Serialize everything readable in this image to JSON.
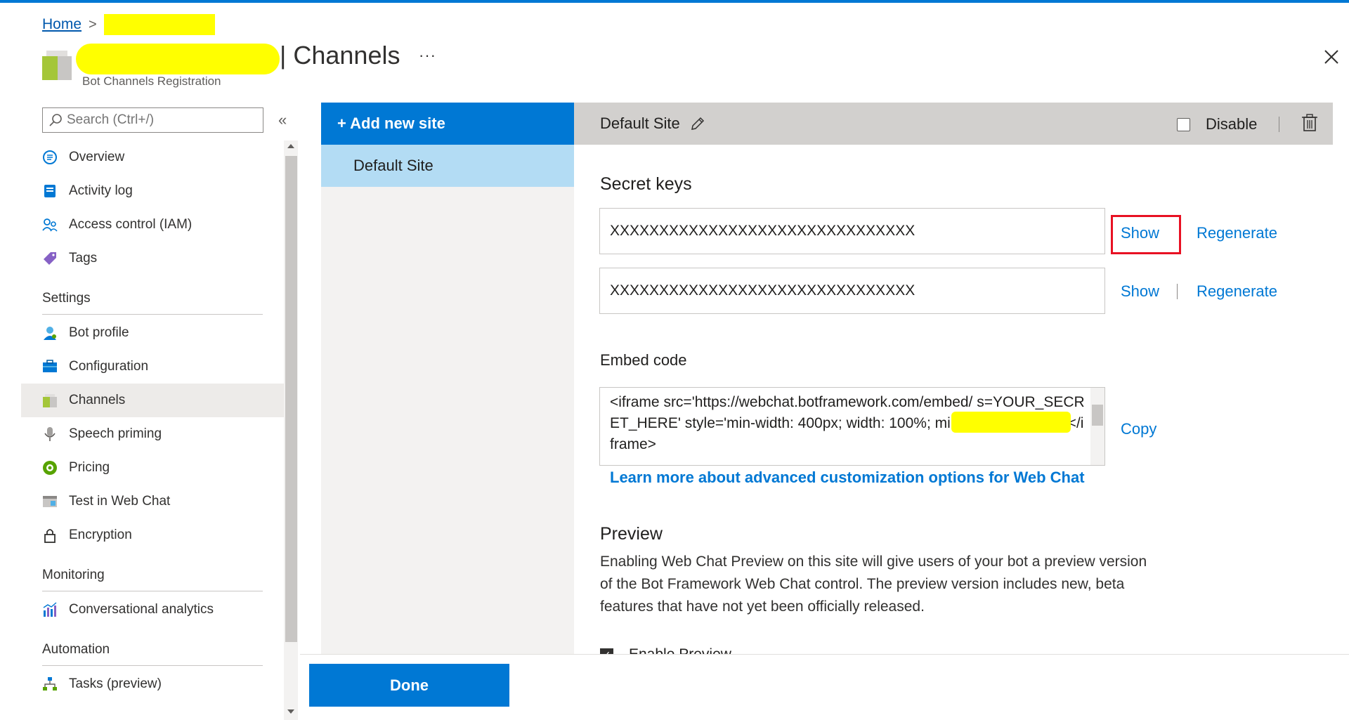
{
  "breadcrumb": {
    "home": "Home",
    "separator": ">"
  },
  "header": {
    "title": "| Channels",
    "subtitle": "Bot Channels Registration",
    "more": "···",
    "close_icon": "close-icon"
  },
  "search": {
    "placeholder": "Search (Ctrl+/)"
  },
  "collapse": "«",
  "nav": {
    "items_top": [
      {
        "label": "Overview",
        "icon": "overview-icon"
      },
      {
        "label": "Activity log",
        "icon": "activity-log-icon"
      },
      {
        "label": "Access control (IAM)",
        "icon": "access-control-icon"
      },
      {
        "label": "Tags",
        "icon": "tags-icon"
      }
    ],
    "settings_heading": "Settings",
    "settings_items": [
      {
        "label": "Bot profile",
        "icon": "bot-profile-icon"
      },
      {
        "label": "Configuration",
        "icon": "configuration-icon"
      },
      {
        "label": "Channels",
        "icon": "channels-icon"
      },
      {
        "label": "Speech priming",
        "icon": "speech-priming-icon"
      },
      {
        "label": "Pricing",
        "icon": "pricing-icon"
      },
      {
        "label": "Test in Web Chat",
        "icon": "test-web-chat-icon"
      },
      {
        "label": "Encryption",
        "icon": "lock-icon"
      }
    ],
    "monitoring_heading": "Monitoring",
    "monitoring_items": [
      {
        "label": "Conversational analytics",
        "icon": "analytics-icon"
      }
    ],
    "automation_heading": "Automation",
    "automation_items": [
      {
        "label": "Tasks (preview)",
        "icon": "tasks-icon"
      }
    ]
  },
  "sites": {
    "add_label": "+ Add new site",
    "items": [
      "Default Site"
    ]
  },
  "details": {
    "site_name": "Default Site",
    "disable_label": "Disable",
    "secret_keys_heading": "Secret keys",
    "key1": "XXXXXXXXXXXXXXXXXXXXXXXXXXXXXXX",
    "key2": "XXXXXXXXXXXXXXXXXXXXXXXXXXXXXXX",
    "show_label": "Show",
    "regenerate_label": "Regenerate",
    "embed_heading": "Embed code",
    "embed_code": "<iframe src='https://webchat.botframework.com/embed/ s=YOUR_SECRET_HERE'  style='min-width: 400px; width: 100%; min-height: 500px;'></iframe>",
    "copy_label": "Copy",
    "learn_more": "Learn more about advanced customization options for Web Chat",
    "preview_heading": "Preview",
    "preview_text": "Enabling Web Chat Preview on this site will give users of your bot a preview version of the Bot Framework Web Chat control. The preview version includes new, beta features that have not yet been officially released.",
    "enable_preview_label": "Enable Preview"
  },
  "footer": {
    "done_label": "Done"
  },
  "colors": {
    "accent": "#0078d4",
    "highlight": "#e81123",
    "redaction": "#ffff00",
    "selected_site": "#b3dcf4"
  }
}
